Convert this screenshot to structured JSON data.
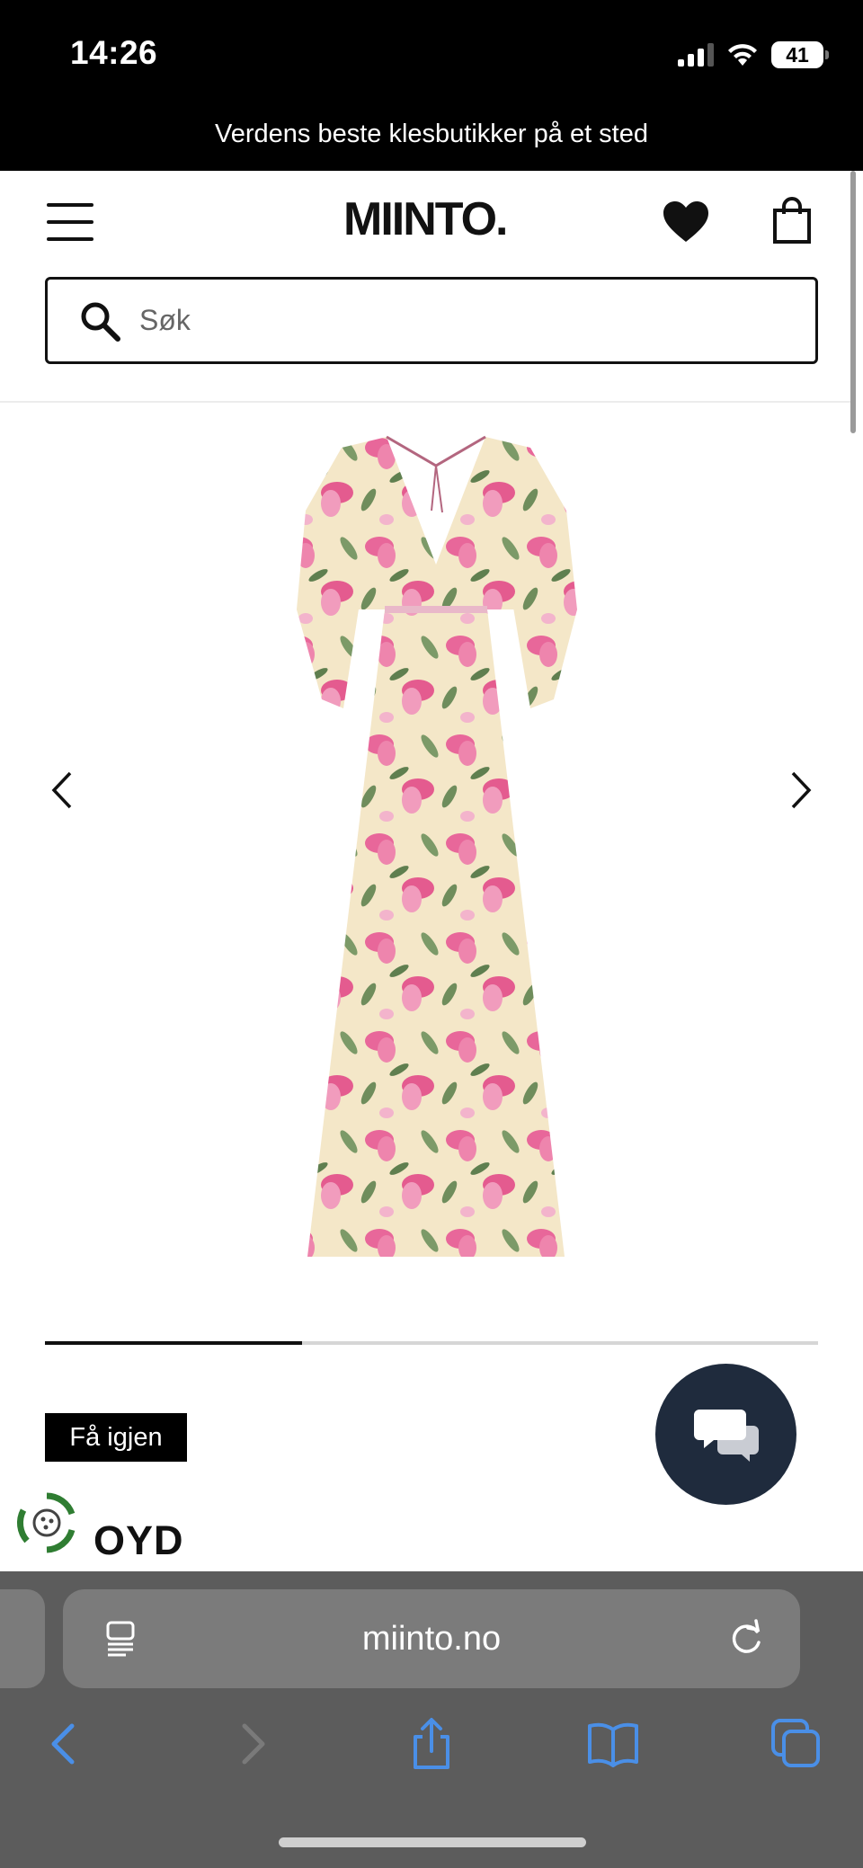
{
  "status_bar": {
    "time": "14:26",
    "battery": "41"
  },
  "promo": {
    "text": "Verdens beste klesbutikker på et sted"
  },
  "header": {
    "logo": "MIINTO."
  },
  "search": {
    "placeholder": "Søk"
  },
  "product": {
    "image_description_icon": "floral-maxi-dress",
    "gallery_progress": 0.333
  },
  "badge": {
    "label": "Få igjen"
  },
  "brand": {
    "name": "OYD"
  },
  "browser": {
    "url": "miinto.no"
  },
  "colors": {
    "chat_button": "#1f2b3d",
    "browser_accent": "#4a8fe7",
    "browser_bar": "#5c5c5c",
    "brand_green": "#2f7d32"
  }
}
